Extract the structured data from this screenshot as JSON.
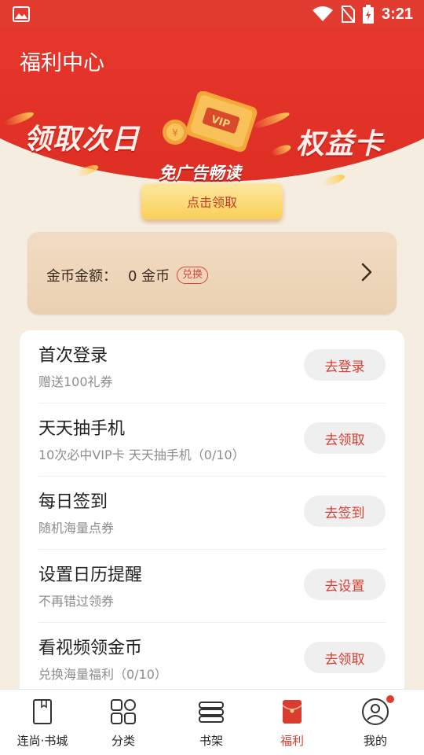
{
  "status_bar": {
    "time": "3:21"
  },
  "header": {
    "title": "福利中心"
  },
  "banner": {
    "left_text": "领取次日",
    "right_text": "权益卡",
    "sub_text": "免广告畅读",
    "claim_label": "点击领取"
  },
  "coins": {
    "label": "金币金额：",
    "value": "0 金币",
    "exchange_label": "兑换"
  },
  "tasks": [
    {
      "title": "首次登录",
      "subtitle": "赠送100礼券",
      "button": "去登录"
    },
    {
      "title": "天天抽手机",
      "subtitle": "10次必中VIP卡 天天抽手机（0/10）",
      "button": "去领取"
    },
    {
      "title": "每日签到",
      "subtitle": "随机海量点券",
      "button": "去签到"
    },
    {
      "title": "设置日历提醒",
      "subtitle": "不再错过领券",
      "button": "去设置"
    },
    {
      "title": "看视频领金币",
      "subtitle": "兑换海量福利（0/10）",
      "button": "去领取"
    }
  ],
  "nav": {
    "items": [
      {
        "label": "连尚·书城",
        "icon": "book-icon"
      },
      {
        "label": "分类",
        "icon": "grid-icon"
      },
      {
        "label": "书架",
        "icon": "bookshelf-icon"
      },
      {
        "label": "福利",
        "icon": "red-envelope-icon",
        "active": true
      },
      {
        "label": "我的",
        "icon": "user-icon"
      }
    ]
  },
  "colors": {
    "accent": "#e23b30",
    "button_text": "#d84034",
    "background": "#f6ede1"
  }
}
